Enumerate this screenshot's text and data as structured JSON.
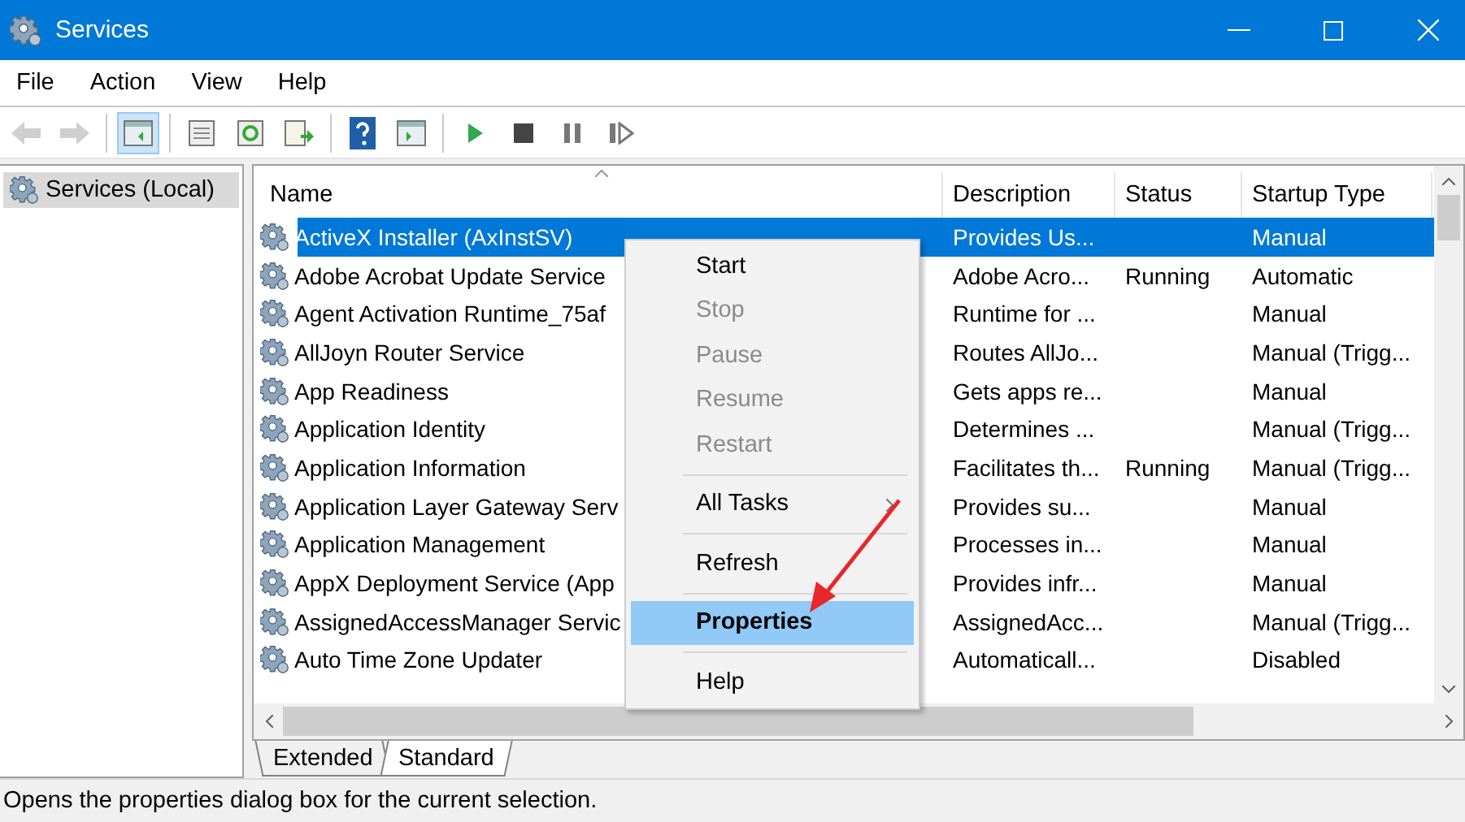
{
  "window": {
    "title": "Services"
  },
  "menu_bar": [
    "File",
    "Action",
    "View",
    "Help"
  ],
  "toolbar": [
    {
      "kind": "back",
      "disabled": true,
      "pressed": false
    },
    {
      "kind": "forward",
      "disabled": true,
      "pressed": false
    },
    {
      "kind": "separator"
    },
    {
      "kind": "console-tree",
      "disabled": false,
      "pressed": true
    },
    {
      "kind": "separator"
    },
    {
      "kind": "properties",
      "disabled": false,
      "pressed": false
    },
    {
      "kind": "refresh",
      "disabled": false,
      "pressed": false
    },
    {
      "kind": "export",
      "disabled": false,
      "pressed": false
    },
    {
      "kind": "separator"
    },
    {
      "kind": "help",
      "disabled": false,
      "pressed": false
    },
    {
      "kind": "action-pane",
      "disabled": false,
      "pressed": false
    },
    {
      "kind": "separator"
    },
    {
      "kind": "start",
      "disabled": false,
      "pressed": false
    },
    {
      "kind": "stop",
      "disabled": false,
      "pressed": false
    },
    {
      "kind": "pause",
      "disabled": false,
      "pressed": false
    },
    {
      "kind": "resume",
      "disabled": false,
      "pressed": false
    }
  ],
  "tree": {
    "items": [
      {
        "label": "Services (Local)",
        "selected": true
      }
    ]
  },
  "table": {
    "columns": [
      "Name",
      "Description",
      "Status",
      "Startup Type"
    ],
    "rows": [
      {
        "name": "ActiveX Installer (AxInstSV)",
        "description": "Provides Us...",
        "startup_type": "Manual",
        "selected": true
      },
      {
        "name": "Adobe Acrobat Update Service",
        "description": "Adobe Acro...",
        "status": "Running",
        "startup_type": "Automatic",
        "selected": false
      },
      {
        "name": "Agent Activation Runtime_75af",
        "description": "Runtime for ...",
        "startup_type": "Manual",
        "selected": false
      },
      {
        "name": "AllJoyn Router Service",
        "description": "Routes AllJo...",
        "startup_type": "Manual (Trigg...",
        "selected": false
      },
      {
        "name": "App Readiness",
        "description": "Gets apps re...",
        "startup_type": "Manual",
        "selected": false
      },
      {
        "name": "Application Identity",
        "description": "Determines ...",
        "startup_type": "Manual (Trigg...",
        "selected": false
      },
      {
        "name": "Application Information",
        "description": "Facilitates th...",
        "status": "Running",
        "startup_type": "Manual (Trigg...",
        "selected": false
      },
      {
        "name": "Application Layer Gateway Serv",
        "description": "Provides su...",
        "startup_type": "Manual",
        "selected": false
      },
      {
        "name": "Application Management",
        "description": "Processes in...",
        "startup_type": "Manual",
        "selected": false
      },
      {
        "name": "AppX Deployment Service (App",
        "description": "Provides infr...",
        "startup_type": "Manual",
        "selected": false
      },
      {
        "name": "AssignedAccessManager Servic",
        "description": "AssignedAcc...",
        "startup_type": "Manual (Trigg...",
        "selected": false
      },
      {
        "name": "Auto Time Zone Updater",
        "description": "Automaticall...",
        "startup_type": "Disabled",
        "selected": false
      }
    ]
  },
  "view_tabs": [
    {
      "label": "Extended",
      "selected": false
    },
    {
      "label": "Standard",
      "selected": true
    }
  ],
  "context_menu": {
    "items": [
      {
        "kind": "item",
        "label": "Start",
        "disabled": false,
        "selected": false,
        "default": false,
        "submenu": false
      },
      {
        "kind": "item",
        "label": "Stop",
        "disabled": true,
        "selected": false,
        "default": false,
        "submenu": false
      },
      {
        "kind": "item",
        "label": "Pause",
        "disabled": true,
        "selected": false,
        "default": false,
        "submenu": false
      },
      {
        "kind": "item",
        "label": "Resume",
        "disabled": true,
        "selected": false,
        "default": false,
        "submenu": false
      },
      {
        "kind": "item",
        "label": "Restart",
        "disabled": true,
        "selected": false,
        "default": false,
        "submenu": false
      },
      {
        "kind": "separator"
      },
      {
        "kind": "item",
        "label": "All Tasks",
        "disabled": false,
        "selected": false,
        "default": false,
        "submenu": true
      },
      {
        "kind": "separator"
      },
      {
        "kind": "item",
        "label": "Refresh",
        "disabled": false,
        "selected": false,
        "default": false,
        "submenu": false
      },
      {
        "kind": "separator"
      },
      {
        "kind": "item",
        "label": "Properties",
        "disabled": false,
        "selected": true,
        "default": true,
        "submenu": false
      },
      {
        "kind": "separator"
      },
      {
        "kind": "item",
        "label": "Help",
        "disabled": false,
        "selected": false,
        "default": false,
        "submenu": false
      }
    ]
  },
  "status_bar": "Opens the properties dialog box for the current selection."
}
